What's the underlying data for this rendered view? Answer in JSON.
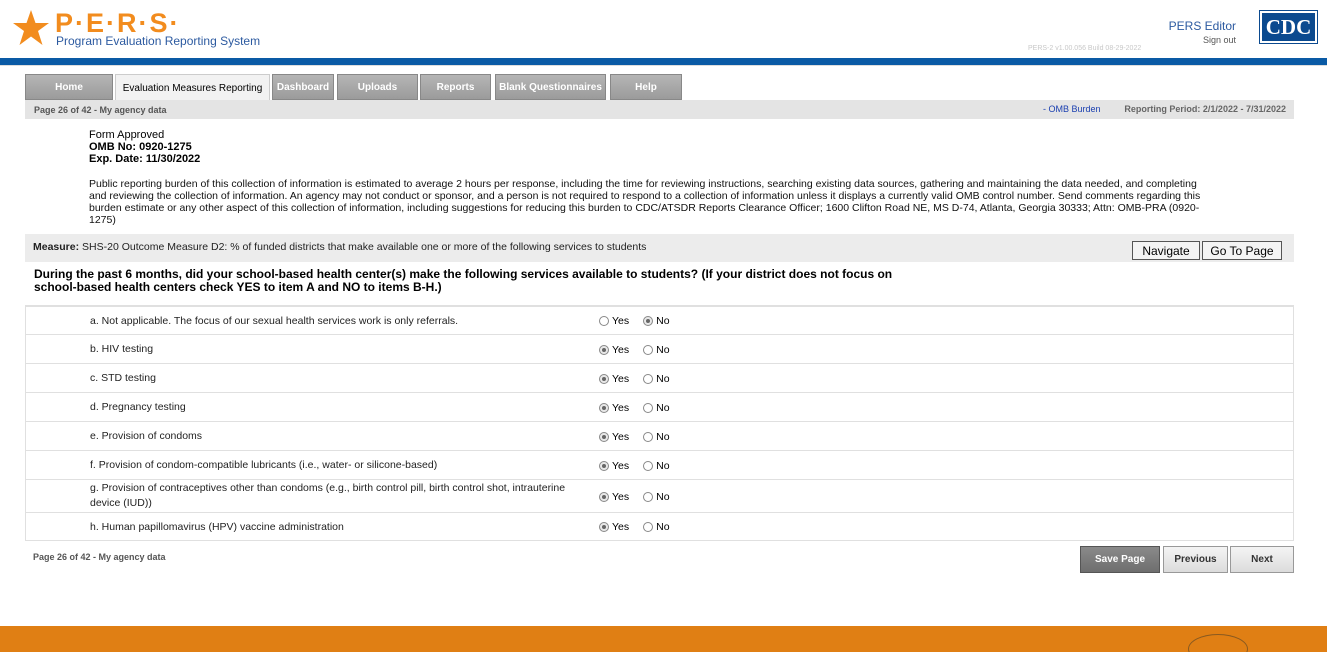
{
  "header": {
    "logo_word": "P·E·R·S·",
    "logo_subtitle": "Program Evaluation Reporting System",
    "user_name": "PERS Editor",
    "sign_out": "Sign out",
    "agency_logo": "CDC",
    "version": "PERS-2 v1.00.056   Build 08-29-2022"
  },
  "tabs": [
    {
      "label": "Home",
      "active": false
    },
    {
      "label": "Evaluation Measures Reporting",
      "active": true
    },
    {
      "label": "Dashboard",
      "active": false
    },
    {
      "label": "Uploads",
      "active": false
    },
    {
      "label": "Reports",
      "active": false
    },
    {
      "label": "Blank Questionnaires",
      "active": false
    },
    {
      "label": "Help",
      "active": false
    }
  ],
  "status": {
    "page_info": "Page 26 of 42 - My agency data",
    "omb_link": "- OMB Burden",
    "reporting_period": "Reporting Period: 2/1/2022 - 7/31/2022"
  },
  "form_approved": {
    "line1": "Form Approved",
    "line2": "OMB No: 0920-1275",
    "line3": "Exp. Date: 11/30/2022"
  },
  "burden_text": "Public reporting burden of this collection of information is estimated to average 2 hours per response, including the time for reviewing instructions, searching existing data sources, gathering and maintaining the data needed, and completing and reviewing the collection of information. An agency may not conduct or sponsor, and a person is not required to respond to a collection of information unless it displays a currently valid OMB control number. Send comments regarding this burden estimate or any other aspect of this collection of information, including suggestions for reducing this burden to CDC/ATSDR Reports Clearance Officer; 1600 Clifton Road NE, MS D-74, Atlanta, Georgia 30333; Attn: OMB-PRA (0920-1275)",
  "measure": {
    "label": "Measure:",
    "text": "SHS-20 Outcome Measure D2: % of funded districts that make available one or more of the following services to students",
    "navigate_button": "Navigate",
    "goto_button": "Go To Page"
  },
  "question": "During the past 6 months, did your school-based health center(s) make the following services available to students? (If your district does not focus on school-based health centers check YES to item A and NO to items B-H.)",
  "options": {
    "yes": "Yes",
    "no": "No"
  },
  "items": [
    {
      "label": "a. Not applicable. The focus of our sexual health services work is only referrals.",
      "answer": "No"
    },
    {
      "label": "b. HIV testing",
      "answer": "Yes"
    },
    {
      "label": "c. STD testing",
      "answer": "Yes"
    },
    {
      "label": "d. Pregnancy testing",
      "answer": "Yes"
    },
    {
      "label": "e. Provision of condoms",
      "answer": "Yes"
    },
    {
      "label": "f. Provision of condom-compatible lubricants (i.e., water- or silicone-based)",
      "answer": "Yes"
    },
    {
      "label": "g. Provision of contraceptives other than condoms (e.g., birth control pill, birth control shot, intrauterine device (IUD))",
      "answer": "Yes"
    },
    {
      "label": "h. Human papillomavirus (HPV) vaccine administration",
      "answer": "Yes"
    }
  ],
  "footer": {
    "page_info": "Page 26 of 42 - My agency data",
    "save_button": "Save Page",
    "previous_button": "Previous",
    "next_button": "Next"
  },
  "colors": {
    "brand_orange": "#f28c1e",
    "brand_blue": "#0a5aa5",
    "footer_orange": "#e07f14"
  }
}
